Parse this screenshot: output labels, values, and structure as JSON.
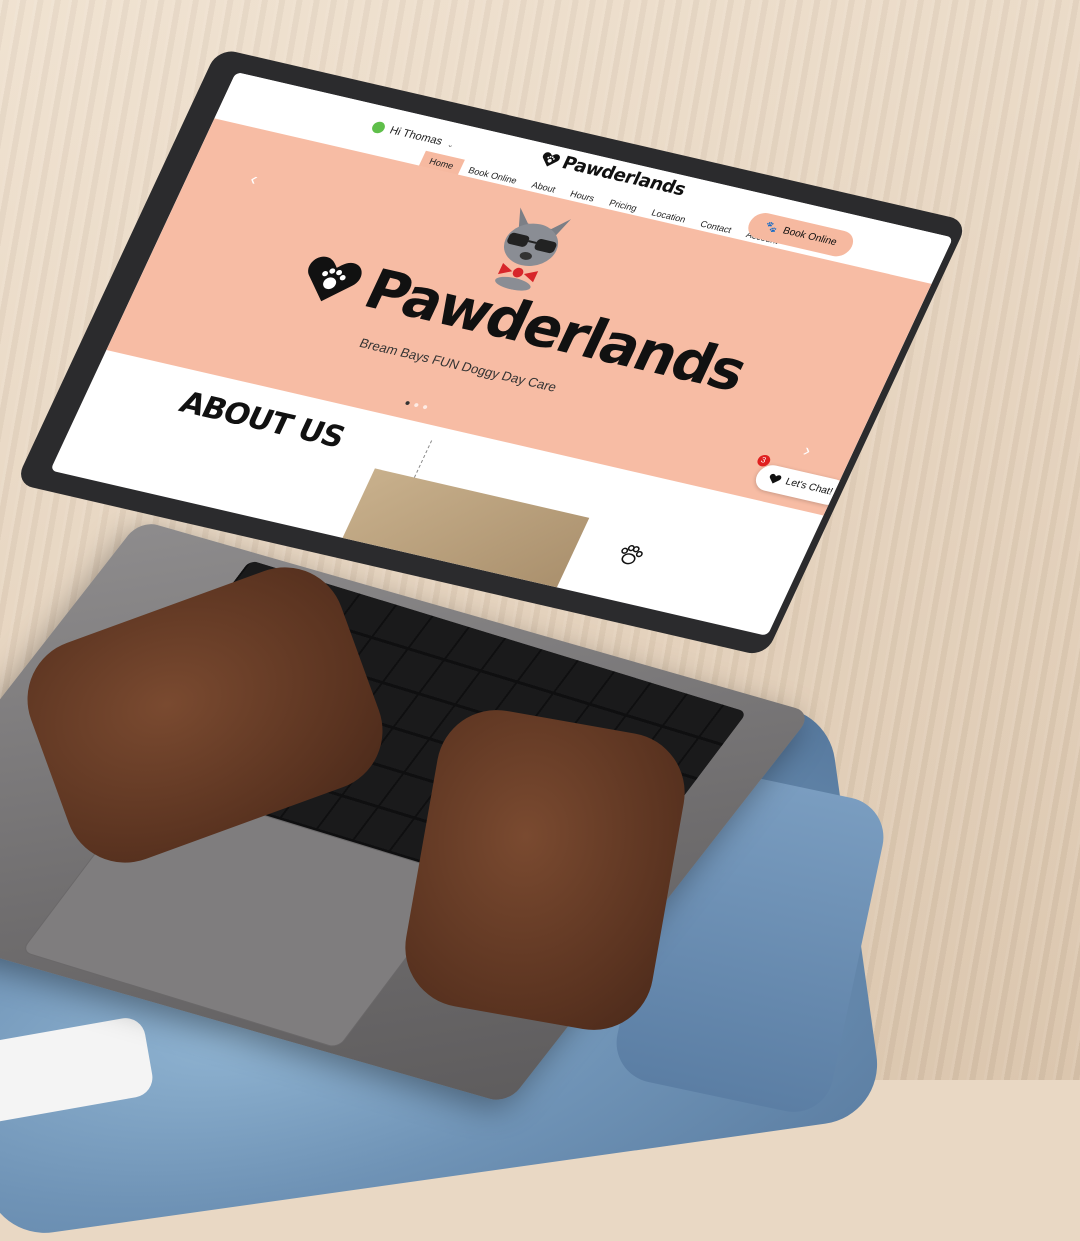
{
  "site": {
    "user_greeting": "Hi Thomas",
    "brand_name": "Pawderlands",
    "nav": [
      "Home",
      "Book Online",
      "About",
      "Hours",
      "Pricing",
      "Location",
      "Contact",
      "Account"
    ],
    "cta_label": "Book Online",
    "hero_title": "Pawderlands",
    "hero_tagline": "Bream Bays FUN Doggy Day Care",
    "section_title": "ABOUT US",
    "chat_label": "Let's Chat!",
    "chat_badge": "3"
  },
  "colors": {
    "accent": "#f7bca4",
    "text": "#111111",
    "badge": "#e02020"
  },
  "icons": [
    "heart-paw-icon",
    "paw-icon",
    "chevron-left-icon",
    "chevron-right-icon",
    "avatar-icon",
    "chevron-down-icon"
  ]
}
